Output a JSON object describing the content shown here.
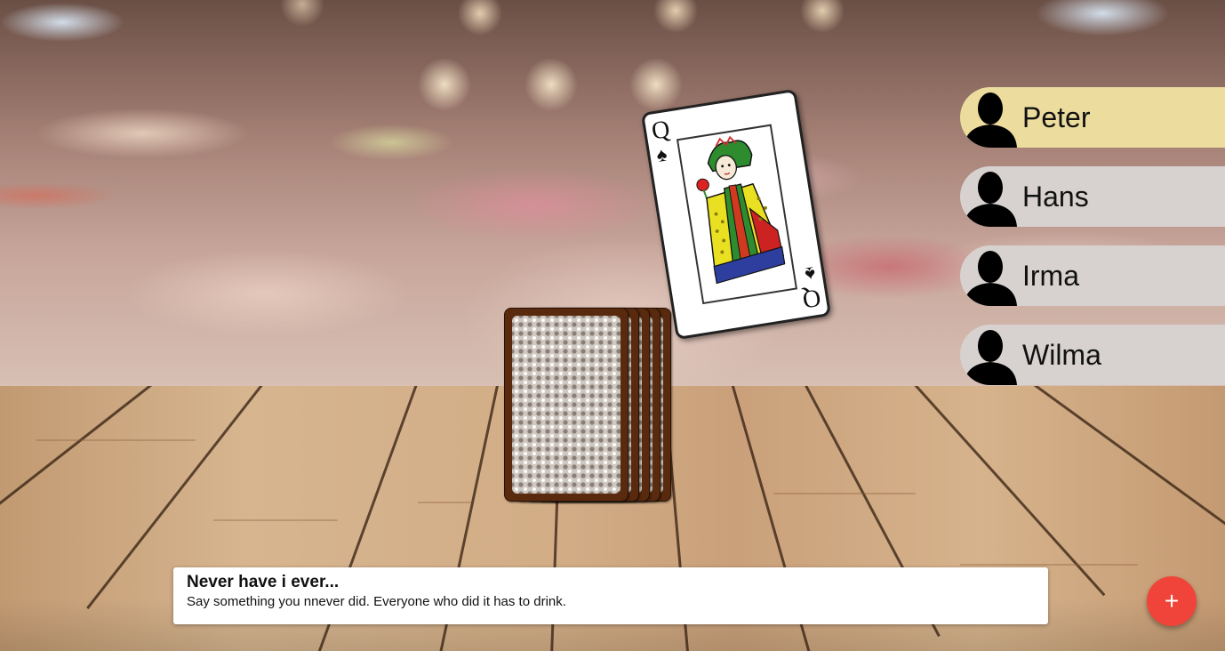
{
  "players": [
    {
      "name": "Peter",
      "active": true
    },
    {
      "name": "Hans",
      "active": false
    },
    {
      "name": "Irma",
      "active": false
    },
    {
      "name": "Wilma",
      "active": false
    }
  ],
  "current_card": {
    "rank": "Q",
    "suit": "♠",
    "suit_name": "spades"
  },
  "deck": {
    "visible_cards": 5
  },
  "rule": {
    "title": "Never have i ever...",
    "text": "Say something you nnever did. Everyone who did it has to drink."
  },
  "fab": {
    "label": "+",
    "icon": "plus-icon"
  },
  "colors": {
    "active_player": "#ecdd9e",
    "inactive_player": "#d7d2cf",
    "fab": "#f0443a",
    "card_back": "#5a2a0e"
  }
}
